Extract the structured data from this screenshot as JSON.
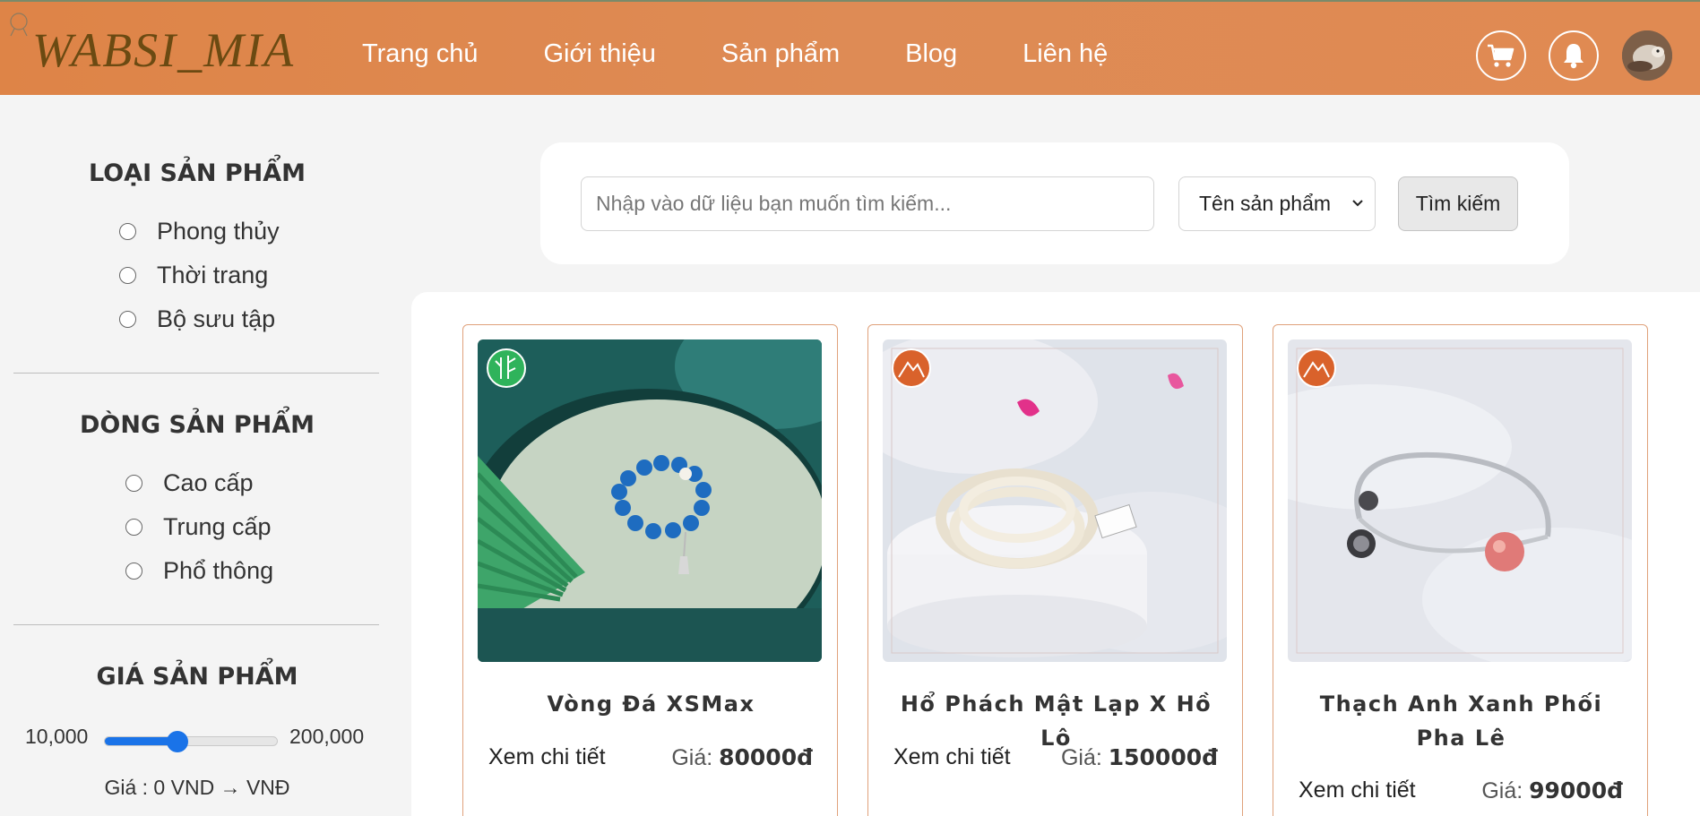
{
  "header": {
    "logo": "WABSI_MIA",
    "nav": [
      "Trang chủ",
      "Giới thiệu",
      "Sản phẩm",
      "Blog",
      "Liên hệ"
    ],
    "icons": [
      "cart-icon",
      "bell-icon",
      "user-avatar"
    ],
    "bg_color": "#de8649",
    "logo_color": "#6b4a12"
  },
  "sidebar": {
    "category": {
      "title": "LOẠI SẢN PHẨM",
      "options": [
        "Phong thủy",
        "Thời trang",
        "Bộ sưu tập"
      ]
    },
    "line": {
      "title": "DÒNG SẢN PHẨM",
      "options": [
        "Cao cấp",
        "Trung cấp",
        "Phổ thông"
      ]
    },
    "price": {
      "title": "GIÁ SẢN PHẨM",
      "min_label": "10,000",
      "max_label": "200,000",
      "slider_fraction": 0.42,
      "text": "Giá : 0 VND → VNĐ"
    }
  },
  "search": {
    "placeholder": "Nhập vào dữ liệu bạn muốn tìm kiếm...",
    "select_value": "Tên sản phẩm",
    "button": "Tìm kiếm"
  },
  "products": [
    {
      "name": "Vòng Đá XSMax",
      "detail": "Xem chi tiết",
      "price_label": "Giá: ",
      "price": "80000đ",
      "badge_color": "#2fb35b"
    },
    {
      "name": "Hổ Phách Mật Lạp X Hồ Lô",
      "detail": "Xem chi tiết",
      "price_label": "Giá: ",
      "price": "150000đ",
      "badge_color": "#d9622b"
    },
    {
      "name": "Thạch Anh Xanh Phối Pha Lê",
      "detail": "Xem chi tiết",
      "price_label": "Giá: ",
      "price": "99000đ",
      "badge_color": "#d9622b"
    }
  ]
}
